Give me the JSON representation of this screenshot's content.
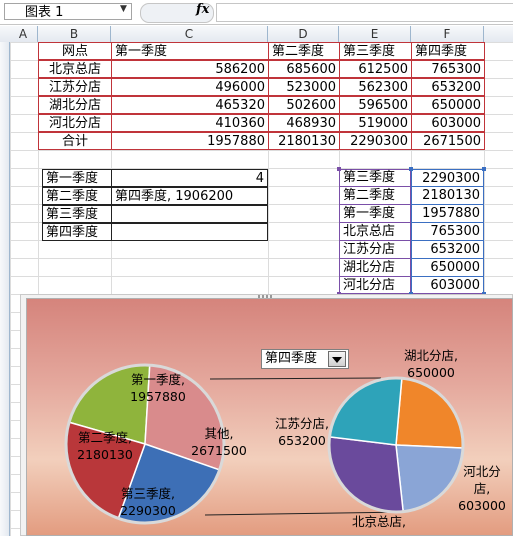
{
  "formula_bar": {
    "name_box": "图表 1",
    "fx": "fx",
    "formula": ""
  },
  "columns": [
    "A",
    "B",
    "C",
    "D",
    "E",
    "F"
  ],
  "main_table": {
    "headers": [
      "网点",
      "第一季度",
      "第二季度",
      "第三季度",
      "第四季度"
    ],
    "rows": [
      [
        "北京总店",
        "586200",
        "685600",
        "612500",
        "765300"
      ],
      [
        "江苏分店",
        "496000",
        "523000",
        "562300",
        "653200"
      ],
      [
        "湖北分店",
        "465320",
        "502600",
        "596500",
        "650000"
      ],
      [
        "河北分店",
        "410360",
        "468930",
        "519000",
        "603000"
      ],
      [
        "合计",
        "1957880",
        "2180130",
        "2290300",
        "2671500"
      ]
    ]
  },
  "lookup_table": {
    "rows": [
      [
        "第一季度",
        "4"
      ],
      [
        "第二季度",
        "第四季度, 1906200"
      ],
      [
        "第三季度",
        ""
      ],
      [
        "第四季度",
        ""
      ]
    ]
  },
  "side_table": {
    "rows": [
      [
        "第三季度",
        "2290300"
      ],
      [
        "第二季度",
        "2180130"
      ],
      [
        "第一季度",
        "1957880"
      ],
      [
        "北京总店",
        "765300"
      ],
      [
        "江苏分店",
        "653200"
      ],
      [
        "湖北分店",
        "650000"
      ],
      [
        "河北分店",
        "603000"
      ]
    ]
  },
  "chart": {
    "dropdown_value": "第四季度",
    "colors": {
      "q1": "#8fb43c",
      "q2": "#b9373a",
      "q3": "#3d6fb6",
      "other": "#d98b8c",
      "bj": "#6a4a9c",
      "js": "#2ea3b9",
      "hb": "#f0862a",
      "hebei": "#8aa5d6"
    }
  },
  "chart_data": [
    {
      "type": "pie",
      "categories": [
        "第一季度",
        "其他",
        "第三季度",
        "第二季度"
      ],
      "values": [
        1957880,
        2671500,
        2290300,
        2180130
      ],
      "data_labels": [
        "第一季度,\n1957880",
        "其他,\n2671500",
        "第三季度,\n2290300",
        "第二季度,\n2180130"
      ]
    },
    {
      "type": "pie",
      "categories": [
        "湖北分店",
        "河北分店",
        "北京总店",
        "江苏分店"
      ],
      "values": [
        650000,
        603000,
        765300,
        653200
      ],
      "data_labels": [
        "湖北分店,\n650000",
        "河北分\n店,\n603000",
        "北京总店,",
        "江苏分店,\n653200"
      ]
    }
  ]
}
